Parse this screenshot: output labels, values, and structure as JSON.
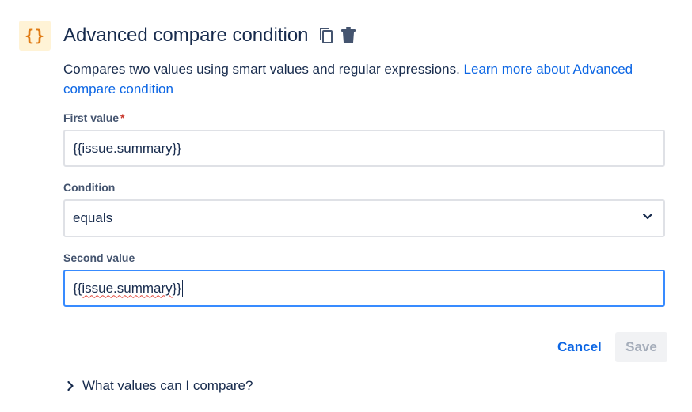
{
  "header": {
    "icon_glyph": "{}",
    "icon_name": "curly-braces-icon",
    "title": "Advanced compare condition",
    "actions": [
      {
        "name": "copy-icon"
      },
      {
        "name": "trash-icon"
      }
    ]
  },
  "description": {
    "text": "Compares two values using smart values and regular expressions. ",
    "link_text": "Learn more about Advanced compare condition"
  },
  "fields": {
    "first_value": {
      "label": "First value",
      "required_marker": "*",
      "value": "{{issue.summary}}"
    },
    "condition": {
      "label": "Condition",
      "selected": "equals"
    },
    "second_value": {
      "label": "Second value",
      "value_prefix": "{{",
      "value_spell": "issue.summary",
      "value_suffix": "}}"
    }
  },
  "buttons": {
    "cancel": "Cancel",
    "save": "Save"
  },
  "expander": {
    "label": "What values can I compare?"
  },
  "colors": {
    "accent": "#0c66e4",
    "icon_bg": "#fff3d6",
    "icon_fg": "#e07b14",
    "required": "#c9372c",
    "focus_border": "#388bff"
  }
}
